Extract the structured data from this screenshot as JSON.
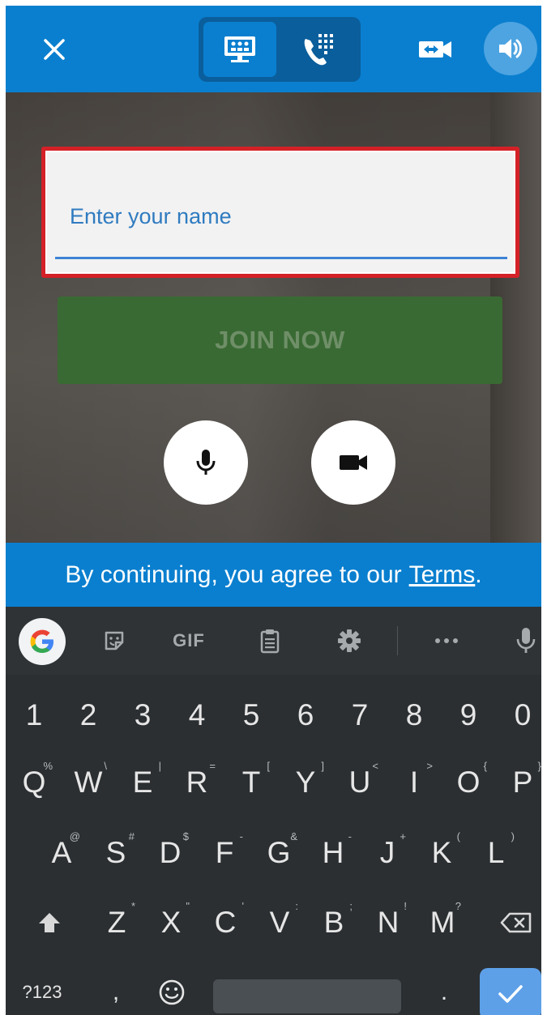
{
  "colors": {
    "brand_blue": "#0a7fcf",
    "toggle_dark": "#0a5e9b",
    "input_border_red": "#d42127",
    "join_green": "#3a6a34",
    "keyboard_bg": "#2b2f32",
    "enter_key_blue": "#5ea0e8"
  },
  "header": {
    "close_icon": "close-icon",
    "modes": [
      {
        "icon": "screen-share-icon",
        "active": true
      },
      {
        "icon": "dialpad-phone-icon",
        "active": false
      }
    ],
    "camera_switch_icon": "switch-camera-icon",
    "speaker_icon": "speaker-icon"
  },
  "join_form": {
    "name_placeholder": "Enter your name",
    "join_label": "JOIN NOW",
    "mic_icon": "microphone-icon",
    "video_icon": "video-camera-icon"
  },
  "terms": {
    "prefix": "By continuing, you agree to our",
    "link": "Terms",
    "suffix": "."
  },
  "keyboard": {
    "toolbar": {
      "gif_label": "GIF",
      "icons": [
        "google-icon",
        "sticker-icon",
        "gif-icon",
        "clipboard-icon",
        "settings-icon",
        "more-icon",
        "voice-input-icon"
      ]
    },
    "rows": {
      "numbers": [
        "1",
        "2",
        "3",
        "4",
        "5",
        "6",
        "7",
        "8",
        "9",
        "0"
      ],
      "row1": [
        {
          "k": "Q",
          "h": "%"
        },
        {
          "k": "W",
          "h": "\\"
        },
        {
          "k": "E",
          "h": "|"
        },
        {
          "k": "R",
          "h": "="
        },
        {
          "k": "T",
          "h": "["
        },
        {
          "k": "Y",
          "h": "]"
        },
        {
          "k": "U",
          "h": "<"
        },
        {
          "k": "I",
          "h": ">"
        },
        {
          "k": "O",
          "h": "{"
        },
        {
          "k": "P",
          "h": "}"
        }
      ],
      "row2": [
        {
          "k": "A",
          "h": "@"
        },
        {
          "k": "S",
          "h": "#"
        },
        {
          "k": "D",
          "h": "$"
        },
        {
          "k": "F",
          "h": "-"
        },
        {
          "k": "G",
          "h": "&"
        },
        {
          "k": "H",
          "h": "-"
        },
        {
          "k": "J",
          "h": "+"
        },
        {
          "k": "K",
          "h": "("
        },
        {
          "k": "L",
          "h": ")"
        }
      ],
      "row3": [
        {
          "k": "Z",
          "h": "*"
        },
        {
          "k": "X",
          "h": "\""
        },
        {
          "k": "C",
          "h": "'"
        },
        {
          "k": "V",
          "h": ":"
        },
        {
          "k": "B",
          "h": ";"
        },
        {
          "k": "N",
          "h": "!"
        },
        {
          "k": "M",
          "h": "?"
        }
      ]
    },
    "bottom": {
      "symbols_label": "?123",
      "comma_label": ",",
      "period_label": "."
    }
  }
}
